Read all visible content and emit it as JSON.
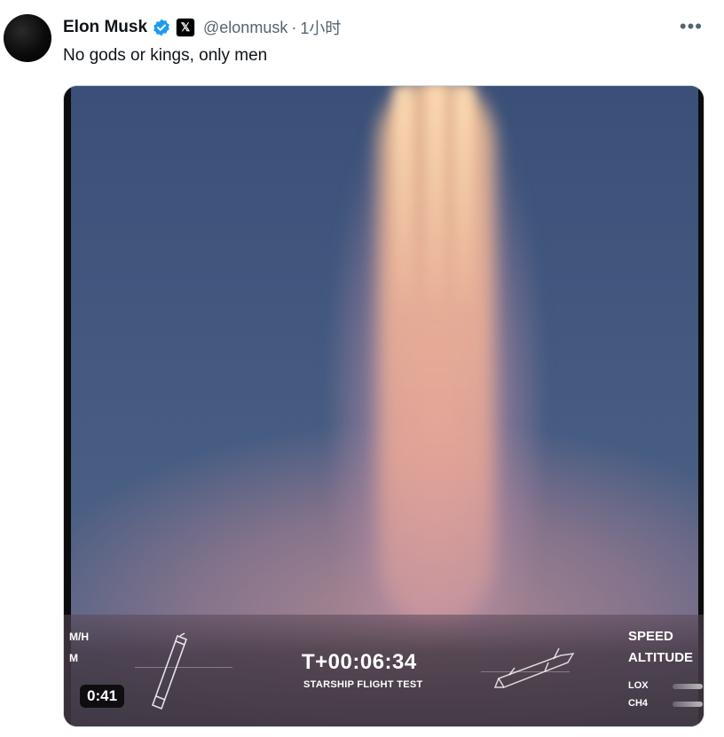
{
  "tweet": {
    "author_name": "Elon Musk",
    "x_badge": "𝕏",
    "handle": "@elonmusk",
    "separator": "·",
    "time": "1小时",
    "more_label": "•••",
    "text": "No gods or kings, only men"
  },
  "video": {
    "duration": "0:41",
    "hud": {
      "left_labels": [
        "M/H",
        "M"
      ],
      "timer": "T+00:06:34",
      "mission": "STARSHIP FLIGHT TEST",
      "speed_label": "SPEED",
      "altitude_label": "ALTITUDE",
      "lox_label": "LOX",
      "ch4_label": "CH4"
    }
  },
  "colors": {
    "verified": "#1d9bf0",
    "secondary_text": "#536471",
    "sky": "#3e5577"
  },
  "icons": {
    "verified": "verified-badge-icon",
    "more": "more-options-icon",
    "booster": "booster-outline-icon",
    "ship": "ship-outline-icon"
  }
}
